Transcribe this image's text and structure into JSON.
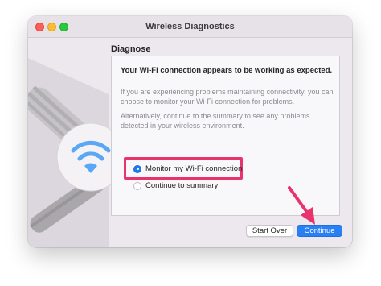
{
  "window": {
    "title": "Wireless Diagnostics"
  },
  "diagnose": {
    "section_title": "Diagnose",
    "headline": "Your Wi-Fi connection appears to be working as expected.",
    "paragraph_1": "If you are experiencing problems maintaining connectivity, you can choose to monitor your Wi-Fi connection for problems.",
    "paragraph_2": "Alternatively, continue to the summary to see any problems detected in your wireless environment.",
    "options": [
      {
        "label": "Monitor my Wi-Fi connection",
        "selected": true
      },
      {
        "label": "Continue to summary",
        "selected": false
      }
    ]
  },
  "buttons": {
    "start_over": "Start Over",
    "continue": "Continue"
  },
  "icons": {
    "wifi": "wifi-icon",
    "annotation_arrow": "arrow-icon"
  },
  "colors": {
    "accent": "#2b7ff5",
    "highlight": "#e8336d",
    "wifi": "#5aa8f5"
  }
}
